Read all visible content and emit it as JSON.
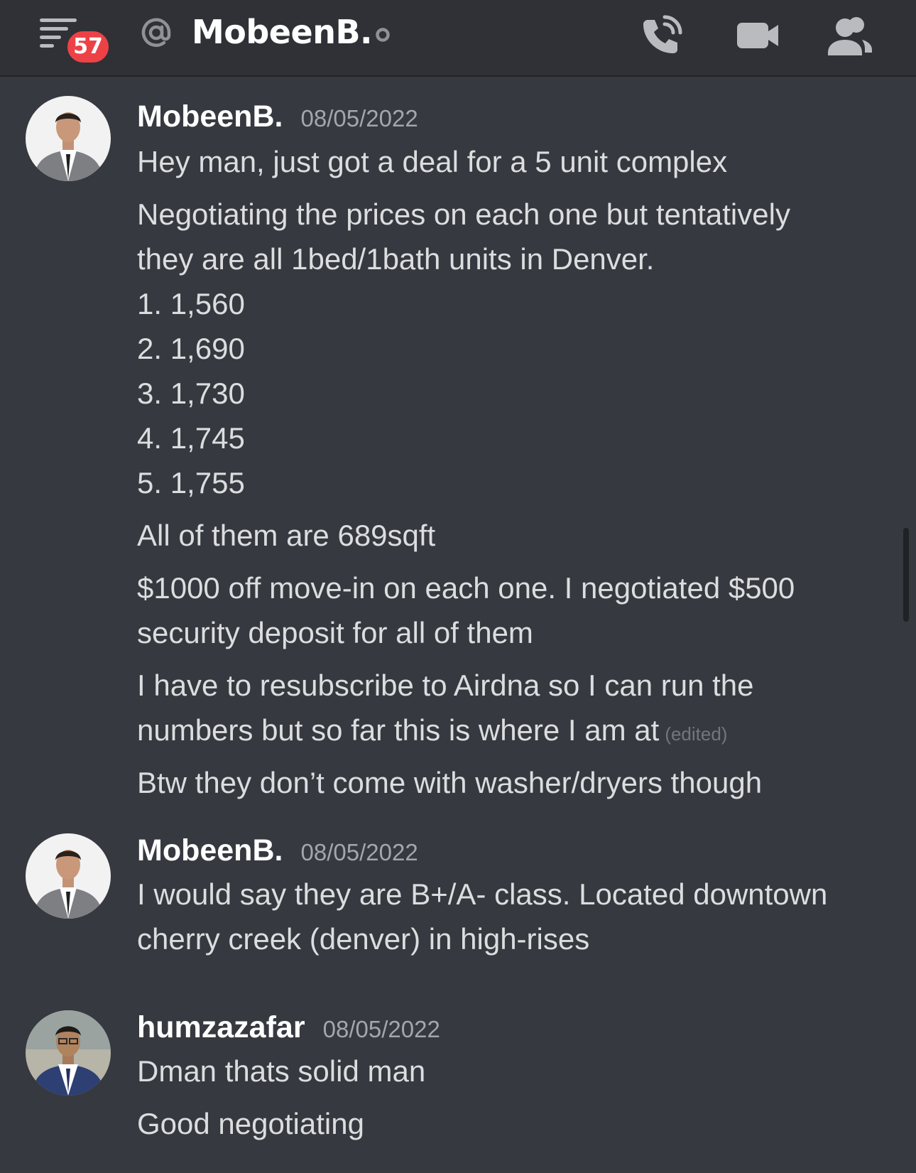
{
  "header": {
    "notification_count": "57",
    "channel_title": "MobeenB.",
    "icons": {
      "menu": "hamburger-menu-icon",
      "mention": "at-sign-icon",
      "status": "offline-status-icon",
      "call": "phone-call-icon",
      "video": "video-camera-icon",
      "members": "members-icon"
    }
  },
  "messages": [
    {
      "author": "MobeenB.",
      "timestamp": "08/05/2022",
      "lines": [
        "Hey man, just got a deal for a 5 unit complex",
        "Negotiating the prices on each one but tentatively",
        "they are all 1bed/1bath units in Denver.",
        "1. 1,560",
        "2. 1,690",
        "3. 1,730",
        "4. 1,745",
        "5. 1,755",
        "All of them are 689sqft",
        "$1000 off move-in on each one. I negotiated $500",
        "security deposit for all of them",
        "I have to resubscribe to Airdna so I can run the",
        "numbers but so far this is where I am at",
        "Btw they don’t come with washer/dryers though"
      ],
      "edited_label": "(edited)"
    },
    {
      "author": "MobeenB.",
      "timestamp": "08/05/2022",
      "lines": [
        "I would say they are B+/A- class. Located downtown",
        "cherry creek (denver) in high-rises"
      ]
    },
    {
      "author": "humzazafar",
      "timestamp": "08/05/2022",
      "lines": [
        "Dman thats solid man",
        "Good negotiating"
      ]
    }
  ],
  "colors": {
    "background": "#36393f",
    "header_background": "#2f3136",
    "badge": "#ed4245",
    "text": "#dcddde",
    "muted": "#a3a6aa"
  }
}
